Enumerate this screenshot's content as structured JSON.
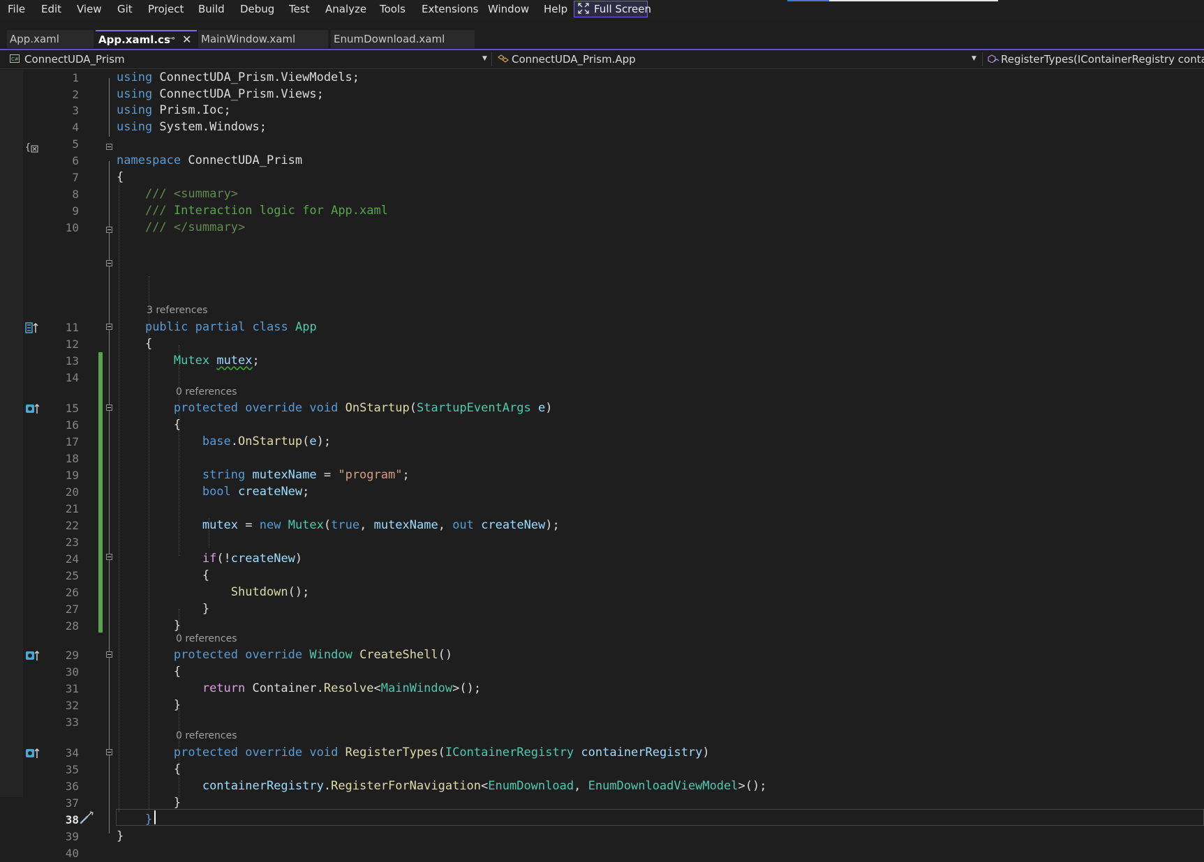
{
  "menu": [
    "File",
    "Edit",
    "View",
    "Git",
    "Project",
    "Build",
    "Debug",
    "Test",
    "Analyze",
    "Tools",
    "Extensions",
    "Window",
    "Help"
  ],
  "fullscreen_label": "Full Screen",
  "tabs": [
    {
      "label": "App.xaml",
      "active": false
    },
    {
      "label": "App.xaml.cs",
      "active": true
    },
    {
      "label": "MainWindow.xaml",
      "active": false
    },
    {
      "label": "EnumDownload.xaml",
      "active": false
    }
  ],
  "navbar": {
    "project": "ConnectUDA_Prism",
    "type": "ConnectUDA_Prism.App",
    "member": "RegisterTypes(IContainerRegistry container"
  },
  "editor": {
    "line_numbers": [
      "1",
      "2",
      "3",
      "4",
      "5",
      "6",
      "7",
      "8",
      "9",
      "10",
      "11",
      "12",
      "13",
      "14",
      "15",
      "16",
      "17",
      "18",
      "19",
      "20",
      "21",
      "22",
      "23",
      "24",
      "25",
      "26",
      "27",
      "28",
      "29",
      "30",
      "31",
      "32",
      "33",
      "34",
      "35",
      "36",
      "37",
      "38",
      "39",
      "40"
    ],
    "current_line": "38",
    "codelens": {
      "class_refs": "3 references",
      "onstartup_refs": "0 references",
      "createshell_refs": "0 references",
      "registertypes_refs": "0 references"
    }
  },
  "colors": {
    "keyword": "#569cd6",
    "control_keyword": "#d8a0df",
    "type": "#4ec9b0",
    "method": "#dcdcaa",
    "variable": "#9cdcfe",
    "string": "#d69d85",
    "comment": "#57a64a",
    "line_number": "#858585",
    "change_bar": "#57a64a",
    "accent": "#7c6fe4"
  },
  "icons": {
    "fullscreen": "fullscreen-icon",
    "csharp_project": "csharp-project-icon",
    "class": "class-icon",
    "method": "method-icon",
    "pin": "pin-icon",
    "close": "close-icon",
    "override": "override-indicator-icon",
    "quick_actions": "screwdriver-icon"
  }
}
